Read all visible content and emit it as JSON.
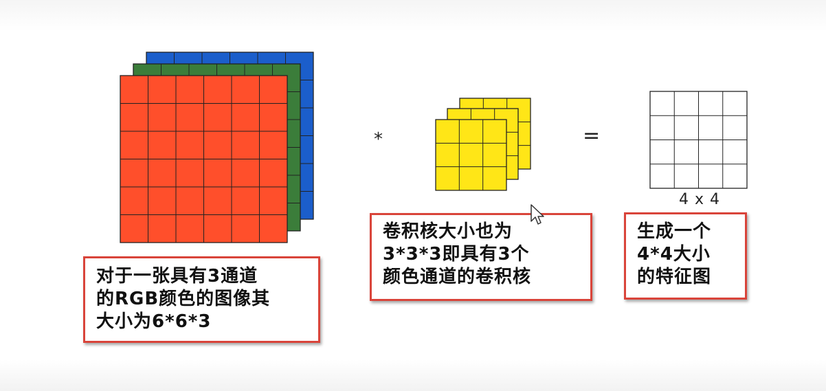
{
  "operators": {
    "convolution": "*",
    "equals": "="
  },
  "output_size_label": "4 x 4",
  "captions": {
    "input": [
      "对于一张具有3通道",
      "的RGB颜色的图像其",
      "大小为6*6*3"
    ],
    "kernel": [
      "卷积核大小也为",
      "3*3*3即具有3个",
      "颜色通道的卷积核"
    ],
    "output": [
      "生成一个",
      "4*4大小",
      "的特征图"
    ]
  },
  "input_image": {
    "grid": 6,
    "channels": 3,
    "colors": [
      "#ff4f2b",
      "#3b7d3a",
      "#1b5ecb"
    ]
  },
  "kernel": {
    "grid": 3,
    "channels": 3,
    "colors": [
      "#ffe617",
      "#ffe617",
      "#ffe617"
    ]
  },
  "feature_map": {
    "grid": 4,
    "color": "#ffffff"
  },
  "colors": {
    "caption_border": "#d9443a",
    "grid_line": "#222222"
  }
}
